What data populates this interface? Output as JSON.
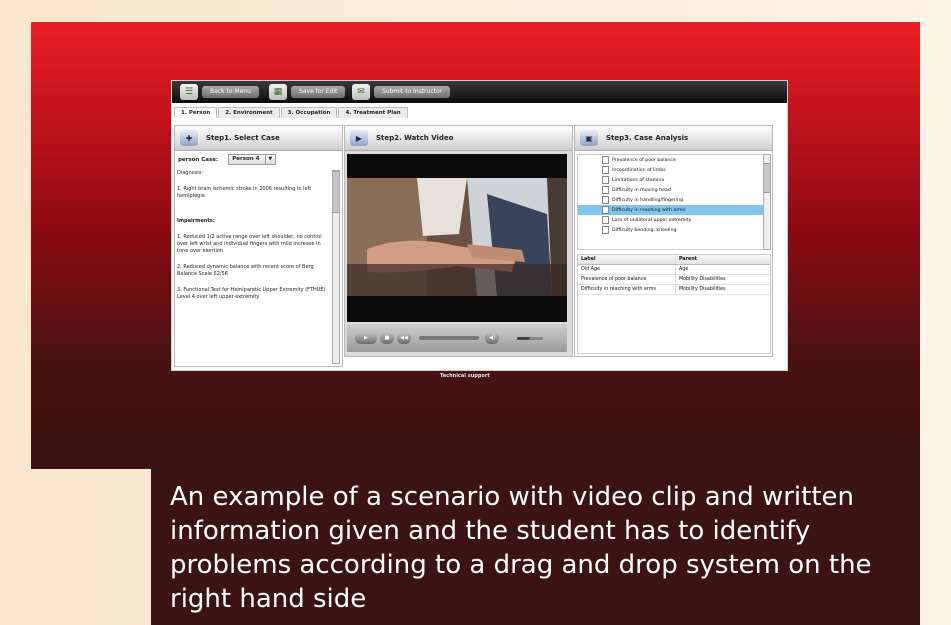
{
  "toolbar": {
    "buttons": [
      {
        "label": "Back to Menu",
        "icon": "menu-icon"
      },
      {
        "label": "Save for Edit",
        "icon": "save-icon"
      },
      {
        "label": "Submit to Instructor",
        "icon": "submit-icon"
      }
    ]
  },
  "tabs": [
    {
      "label": "1. Person",
      "active": true
    },
    {
      "label": "2. Environment",
      "active": false
    },
    {
      "label": "3. Occupation",
      "active": false
    },
    {
      "label": "4. Treatment Plan",
      "active": false
    }
  ],
  "step1": {
    "title": "Step1. Select Case",
    "case_label": "person Case:",
    "case_value": "Person 4",
    "diagnosis_heading": "Diagnosis:",
    "diagnosis_text": "1. Right brain ischemic stroke in 2006 resulting in left hemiplegia",
    "impairments_heading": "Impairments:",
    "impairments": [
      "1. Reduced 1/2 active range over left shoulder, no control over left wrist and individual fingers with mild increase in tone over exertion",
      "2. Reduced dynamic balance with recent score of Berg Balance Scale 52/56",
      "3. Functional Test for Hemiparetic Upper Extremity (FTHUE) Level 4 over left upper extremity"
    ]
  },
  "step2": {
    "title": "Step2. Watch Video",
    "progress": 0.0,
    "volume": 0.5
  },
  "step3": {
    "title": "Step3. Case Analysis",
    "list_items": [
      "Prevalence of poor balance",
      "Incoordination of limbs",
      "Limitations of stamina",
      "Difficulty in moving head",
      "Difficulty in handling/fingering",
      "Difficulty in reaching with arms",
      "Loss of unilateral upper extremity",
      "Difficulty bending, kneeling"
    ],
    "selected_index": 5,
    "grid_headers": [
      "Label",
      "Parent"
    ],
    "grid_rows": [
      [
        "Old Age",
        "Age"
      ],
      [
        "Prevalence of poor balance",
        "Mobility Disabilities"
      ],
      [
        "Difficulty in reaching with arms",
        "Mobility Disabilities"
      ]
    ]
  },
  "footer": {
    "support": "Technical support"
  },
  "caption": "An example of a scenario with video clip and written information given and the student has to identify problems according to a drag and drop system  on the right hand side",
  "colors": {
    "slide_top": "#ea1f27",
    "slide_bottom": "#3b1313",
    "selected_row": "#7dc6ee",
    "page_bg": "#fbe6cf"
  }
}
